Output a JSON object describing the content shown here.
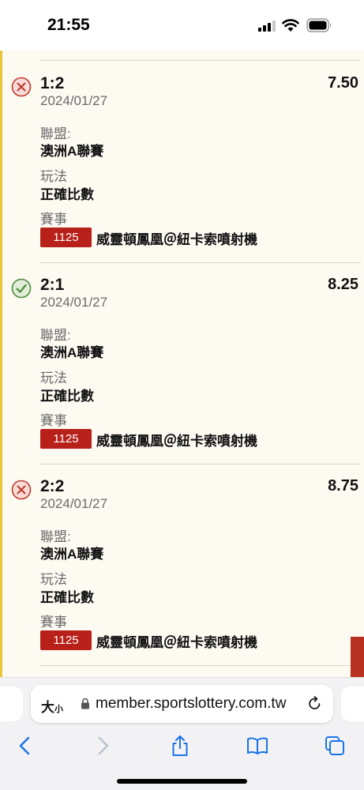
{
  "status_bar": {
    "time": "21:55"
  },
  "bets": [
    {
      "score": "1:2",
      "odds": "7.50",
      "date": "2024/01/27",
      "result_icon": "cross-circle-icon",
      "league_label": "聯盟:",
      "league": "澳洲A聯賽",
      "play_label": "玩法",
      "play": "正確比數",
      "match_label": "賽事",
      "match_code": "1125",
      "match_name": "威靈頓鳳凰＠紐卡索噴射機"
    },
    {
      "score": "2:1",
      "odds": "8.25",
      "date": "2024/01/27",
      "result_icon": "check-circle-icon",
      "league_label": "聯盟:",
      "league": "澳洲A聯賽",
      "play_label": "玩法",
      "play": "正確比數",
      "match_label": "賽事",
      "match_code": "1125",
      "match_name": "威靈頓鳳凰＠紐卡索噴射機"
    },
    {
      "score": "2:2",
      "odds": "8.75",
      "date": "2024/01/27",
      "result_icon": "cross-circle-icon",
      "league_label": "聯盟:",
      "league": "澳洲A聯賽",
      "play_label": "玩法",
      "play": "正確比數",
      "match_label": "賽事",
      "match_code": "1125",
      "match_name": "威靈頓鳳凰＠紐卡索噴射機"
    }
  ],
  "browser": {
    "text_size_big": "大",
    "text_size_small": "小",
    "url": "member.sportslottery.com.tw"
  },
  "colors": {
    "lose": "#c0392b",
    "win": "#4e8a3e",
    "badge": "#b8211a",
    "accent": "#e8c53a",
    "link": "#1a73e8"
  }
}
